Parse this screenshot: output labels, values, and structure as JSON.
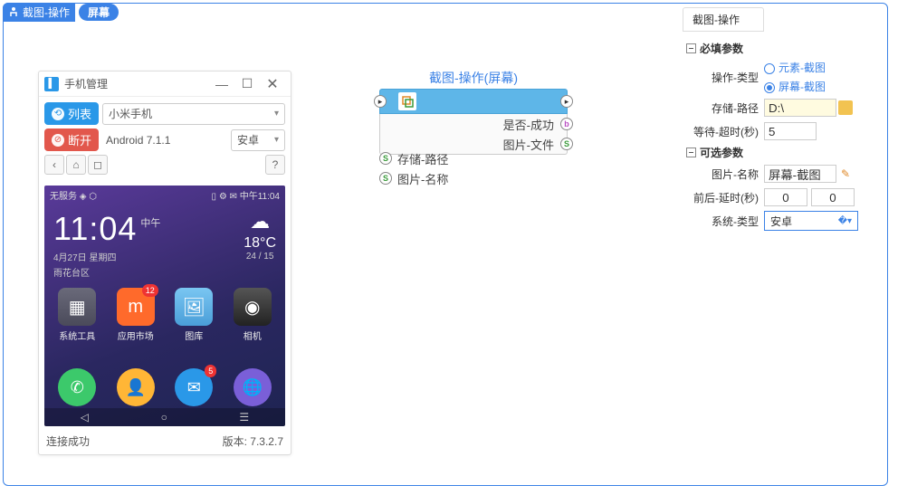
{
  "titlebar": {
    "label": "截图-操作",
    "pill": "屏幕"
  },
  "phone": {
    "title": "手机管理",
    "list_btn": "列表",
    "device": "小米手机",
    "disc_btn": "断开",
    "android": "Android 7.1.1",
    "platform": "安卓",
    "status": "连接成功",
    "version": "版本: 7.3.2.7",
    "screen": {
      "sb_left": "无服务 ◈ ⬡",
      "sb_right": "▯ ⚙ ✉ 中午11:04",
      "time": "11:04",
      "ampm": "中午",
      "date": "4月27日 星期四",
      "loc": "雨花台区",
      "temp": "18°C",
      "range": "24 / 15",
      "apps": [
        {
          "label": "系统工具",
          "badge": ""
        },
        {
          "label": "应用市场",
          "badge": "12"
        },
        {
          "label": "图库",
          "badge": ""
        },
        {
          "label": "相机",
          "badge": ""
        }
      ],
      "dock_msg_badge": "5"
    }
  },
  "node": {
    "title": "截图-操作(屏幕)",
    "out1": "是否-成功",
    "out2": "图片-文件",
    "in1": "存储-路径",
    "in2": "图片-名称"
  },
  "panel": {
    "tab": "截图-操作",
    "grp_req": "必填参数",
    "grp_opt": "可选参数",
    "f_optype": "操作-类型",
    "r_elem": "元素-截图",
    "r_screen": "屏幕-截图",
    "f_path": "存储-路径",
    "v_path": "D:\\",
    "f_timeout": "等待-超时(秒)",
    "v_timeout": "5",
    "f_imgname": "图片-名称",
    "v_imgname": "屏幕-截图",
    "f_delay": "前后-延时(秒)",
    "v_d1": "0",
    "v_d2": "0",
    "f_sys": "系统-类型",
    "v_sys": "安卓"
  }
}
